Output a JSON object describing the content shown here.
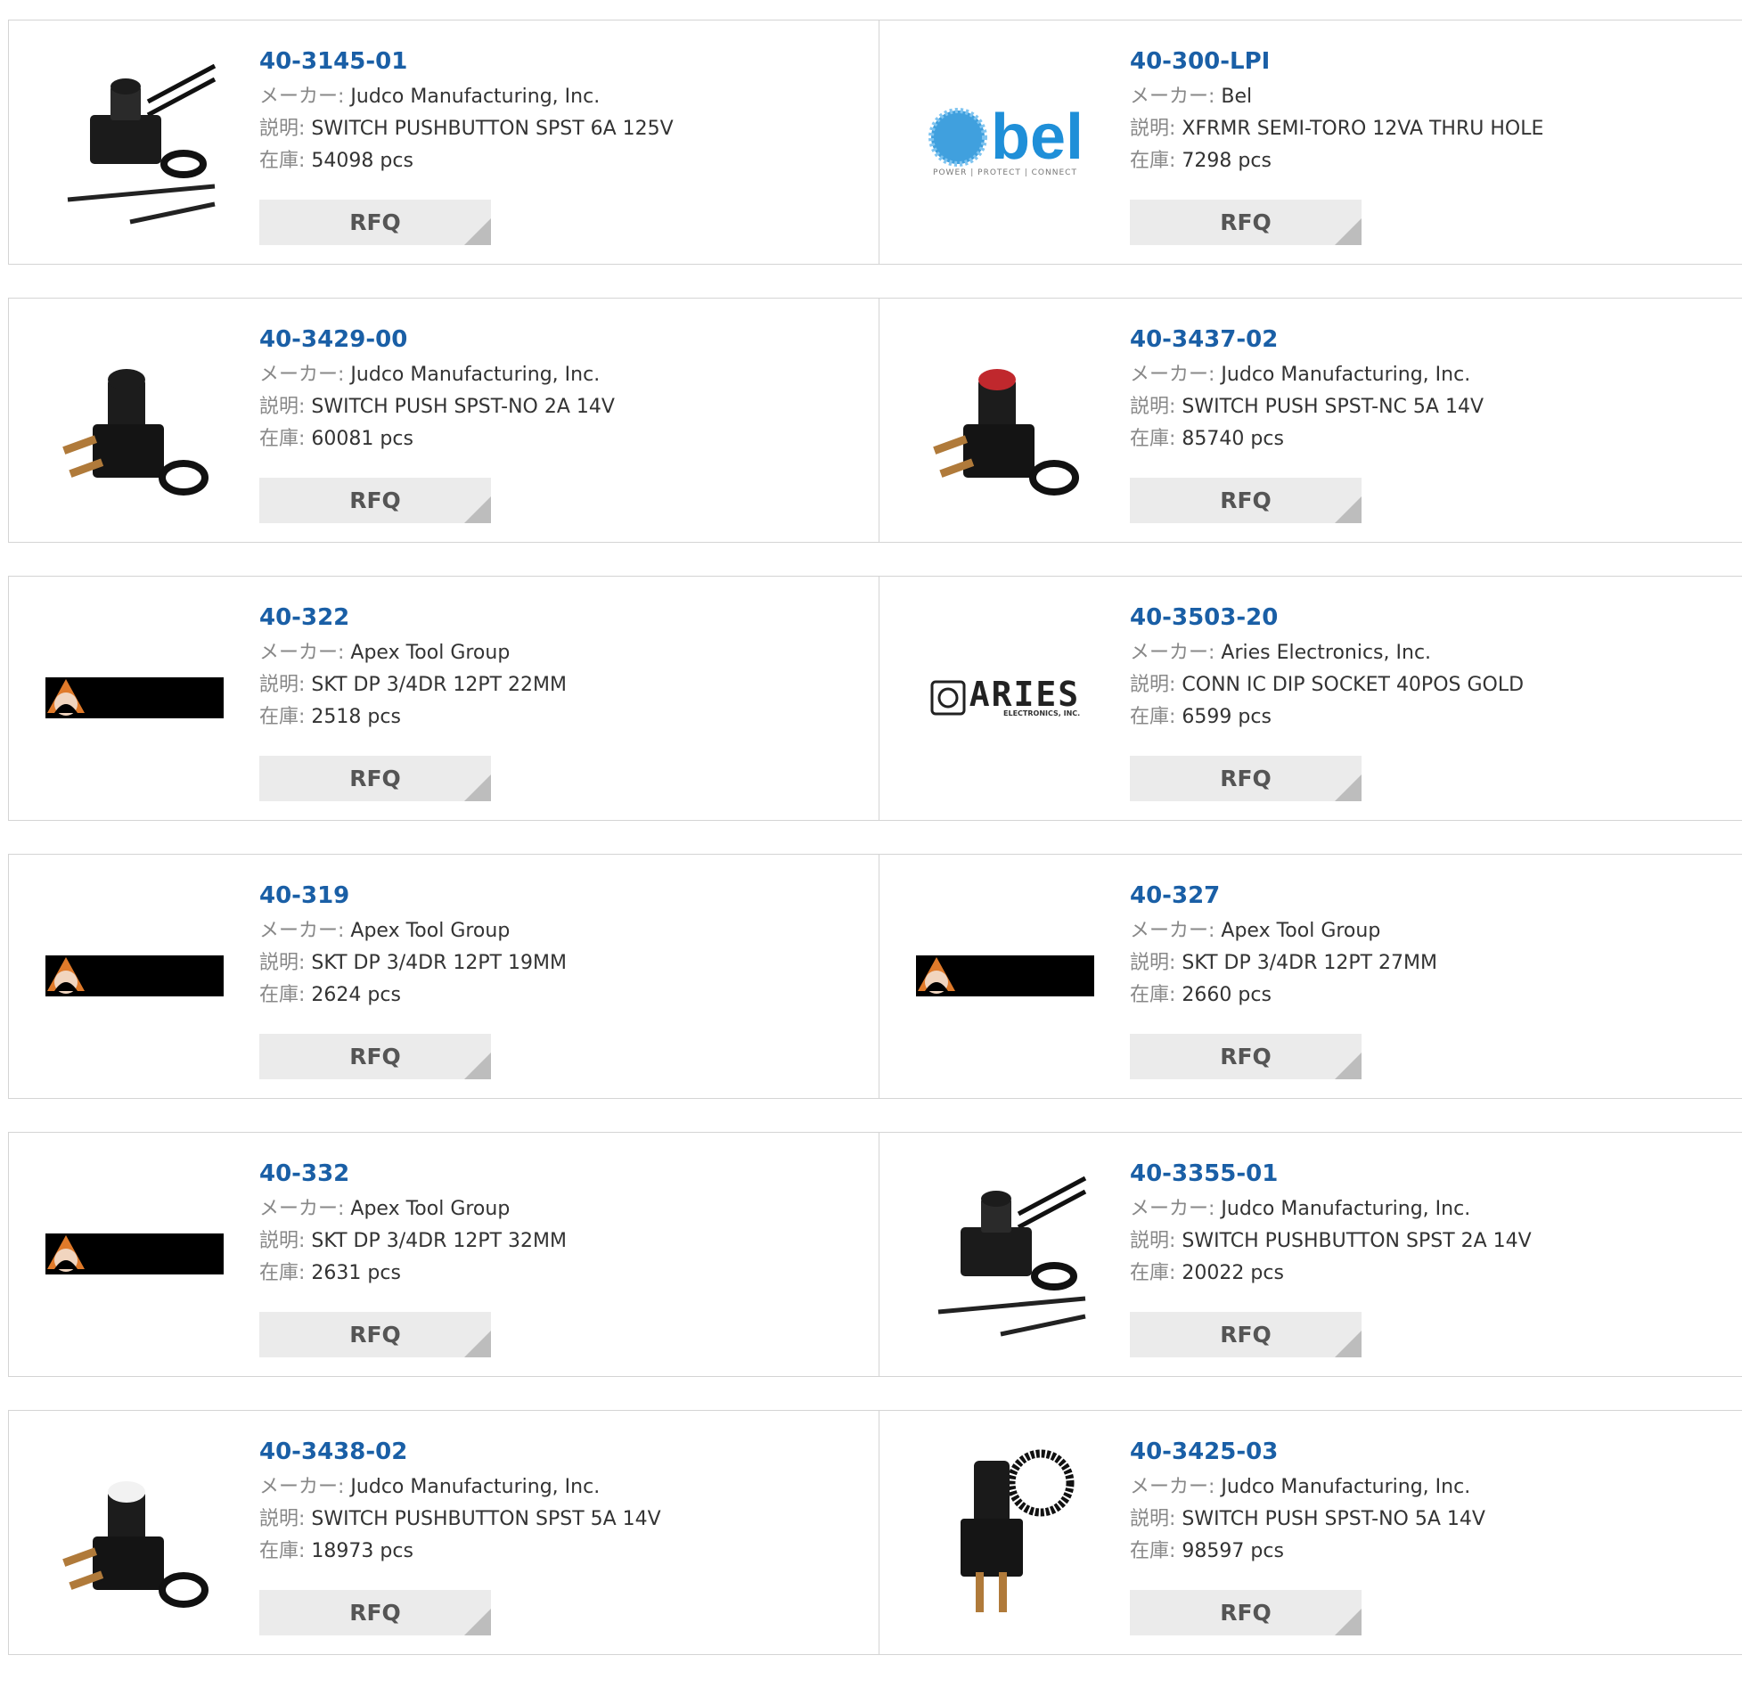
{
  "labels": {
    "maker": "メーカー:",
    "desc": "説明:",
    "stock": "在庫:",
    "rfq": "RFQ"
  },
  "products": [
    {
      "pn": "40-3145-01",
      "maker": "Judco Manufacturing, Inc.",
      "desc": "SWITCH PUSHBUTTON SPST 6A 125V",
      "stock": "54098 pcs",
      "image": "pushbutton-switch-wired-image"
    },
    {
      "pn": "40-300-LPI",
      "maker": "Bel",
      "desc": "XFRMR SEMI-TORO 12VA THRU HOLE",
      "stock": "7298 pcs",
      "image": "bel-logo",
      "logo_text": "bel",
      "logo_tagline": "POWER | PROTECT | CONNECT"
    },
    {
      "pn": "40-3429-00",
      "maker": "Judco Manufacturing, Inc.",
      "desc": "SWITCH PUSH SPST-NO 2A 14V",
      "stock": "60081 pcs",
      "image": "pushbutton-switch-image"
    },
    {
      "pn": "40-3437-02",
      "maker": "Judco Manufacturing, Inc.",
      "desc": "SWITCH PUSH SPST-NC 5A 14V",
      "stock": "85740 pcs",
      "image": "pushbutton-switch-red-image"
    },
    {
      "pn": "40-322",
      "maker": "Apex Tool Group",
      "desc": "SKT DP 3/4DR 12PT 22MM",
      "stock": "2518 pcs",
      "image": "apex-logo"
    },
    {
      "pn": "40-3503-20",
      "maker": "Aries Electronics, Inc.",
      "desc": "CONN IC DIP SOCKET 40POS GOLD",
      "stock": "6599 pcs",
      "image": "aries-logo",
      "logo_text": "ARIES",
      "logo_tagline": "ELECTRONICS, INC."
    },
    {
      "pn": "40-319",
      "maker": "Apex Tool Group",
      "desc": "SKT DP 3/4DR 12PT 19MM",
      "stock": "2624 pcs",
      "image": "apex-logo"
    },
    {
      "pn": "40-327",
      "maker": "Apex Tool Group",
      "desc": "SKT DP 3/4DR 12PT 27MM",
      "stock": "2660 pcs",
      "image": "apex-logo"
    },
    {
      "pn": "40-332",
      "maker": "Apex Tool Group",
      "desc": "SKT DP 3/4DR 12PT 32MM",
      "stock": "2631 pcs",
      "image": "apex-logo"
    },
    {
      "pn": "40-3355-01",
      "maker": "Judco Manufacturing, Inc.",
      "desc": "SWITCH PUSHBUTTON SPST 2A 14V",
      "stock": "20022 pcs",
      "image": "pushbutton-switch-wired-image"
    },
    {
      "pn": "40-3438-02",
      "maker": "Judco Manufacturing, Inc.",
      "desc": "SWITCH PUSHBUTTON SPST 5A 14V",
      "stock": "18973 pcs",
      "image": "pushbutton-switch-white-image"
    },
    {
      "pn": "40-3425-03",
      "maker": "Judco Manufacturing, Inc.",
      "desc": "SWITCH PUSH SPST-NO 5A 14V",
      "stock": "98597 pcs",
      "image": "pushbutton-switch-tall-image"
    }
  ],
  "colors": {
    "link": "#1a5fa6",
    "rfq_bg": "#ebebeb",
    "border": "#d4d4d4",
    "bel_blue": "#1f8fd8",
    "switch_red": "#c0282d"
  }
}
